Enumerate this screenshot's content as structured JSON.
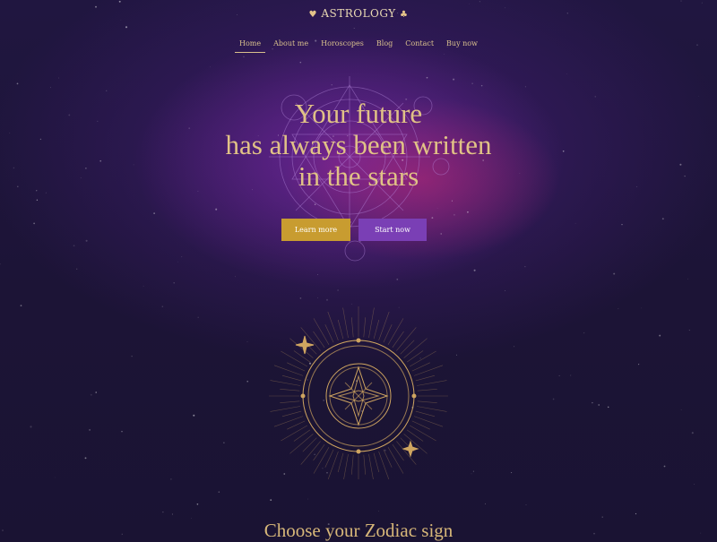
{
  "header": {
    "logo_text": "ASTROLOGY",
    "logo_left_glyph": "♥",
    "logo_right_glyph": "♣"
  },
  "nav": {
    "items": [
      {
        "label": "Home",
        "active": true
      },
      {
        "label": "About me",
        "active": false
      },
      {
        "label": "Horoscopes",
        "active": false
      },
      {
        "label": "Blog",
        "active": false
      },
      {
        "label": "Contact",
        "active": false
      },
      {
        "label": "Buy now",
        "active": false
      }
    ]
  },
  "hero": {
    "headline_line1": "Your future",
    "headline_line2": "has always been written",
    "headline_line3": "in the stars",
    "learn_more_label": "Learn more",
    "start_now_label": "Start now"
  },
  "zodiac": {
    "title": "Choose your Zodiac sign"
  },
  "colors": {
    "gold": "#e1c286",
    "learn_button": "#c89c30",
    "start_button": "#7a3fb5",
    "background": "#1e1537"
  }
}
